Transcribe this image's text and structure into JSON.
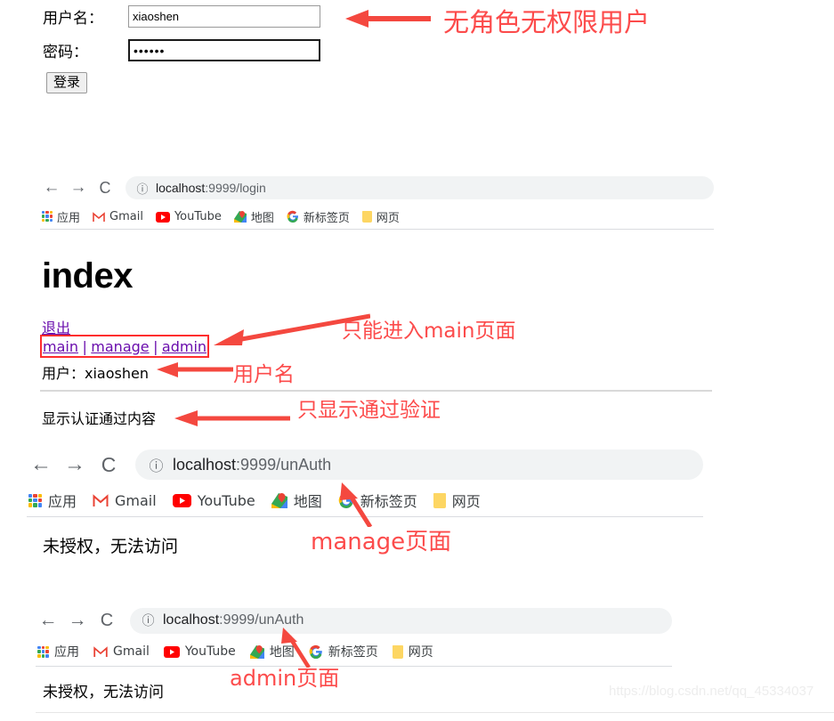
{
  "login_form": {
    "username_label": "用户名：",
    "username_value": "xiaoshen",
    "username_placeholder": "",
    "password_label": "密码：",
    "password_value": "••••••",
    "password_placeholder": "",
    "submit_label": "登录"
  },
  "browsers": [
    {
      "id": "browser-login",
      "back_icon": "←",
      "forward_icon": "→",
      "reload_icon": "C",
      "info_icon": "ⓘ",
      "url_host": "localhost",
      "url_path": ":9999/login",
      "bookmarks": [
        {
          "label": "应用",
          "icon": "apps-grid-icon"
        },
        {
          "label": "Gmail",
          "icon": "gmail-icon"
        },
        {
          "label": "YouTube",
          "icon": "youtube-icon"
        },
        {
          "label": "地图",
          "icon": "google-maps-icon"
        },
        {
          "label": "新标签页",
          "icon": "google-g-icon"
        },
        {
          "label": "网页",
          "icon": "folder-icon"
        }
      ]
    },
    {
      "id": "browser-unauth-manage",
      "back_icon": "←",
      "forward_icon": "→",
      "reload_icon": "C",
      "info_icon": "ⓘ",
      "url_host": "localhost",
      "url_path": ":9999/unAuth",
      "bookmarks": [
        {
          "label": "应用",
          "icon": "apps-grid-icon"
        },
        {
          "label": "Gmail",
          "icon": "gmail-icon"
        },
        {
          "label": "YouTube",
          "icon": "youtube-icon"
        },
        {
          "label": "地图",
          "icon": "google-maps-icon"
        },
        {
          "label": "新标签页",
          "icon": "google-g-icon"
        },
        {
          "label": "网页",
          "icon": "folder-icon"
        }
      ],
      "body_text": "未授权，无法访问"
    },
    {
      "id": "browser-unauth-admin",
      "back_icon": "←",
      "forward_icon": "→",
      "reload_icon": "C",
      "info_icon": "ⓘ",
      "url_host": "localhost",
      "url_path": ":9999/unAuth",
      "bookmarks": [
        {
          "label": "应用",
          "icon": "apps-grid-icon"
        },
        {
          "label": "Gmail",
          "icon": "gmail-icon"
        },
        {
          "label": "YouTube",
          "icon": "youtube-icon"
        },
        {
          "label": "地图",
          "icon": "google-maps-icon"
        },
        {
          "label": "新标签页",
          "icon": "google-g-icon"
        },
        {
          "label": "网页",
          "icon": "folder-icon"
        }
      ],
      "body_text": "未授权，无法访问"
    }
  ],
  "index_page": {
    "heading": "index",
    "logout_link": "退出",
    "nav_links": [
      "main",
      "manage",
      "admin"
    ],
    "nav_separator": "|",
    "user_prefix": "用户：",
    "user_name": "xiaoshen",
    "auth_content": "显示认证通过内容"
  },
  "annotations": [
    {
      "id": "anno-no-role",
      "text": "无角色无权限用户"
    },
    {
      "id": "anno-only-main",
      "text": "只能进入main页面"
    },
    {
      "id": "anno-username",
      "text": "用户名"
    },
    {
      "id": "anno-auth-only",
      "text": "只显示通过验证"
    },
    {
      "id": "anno-manage-page",
      "text": "manage页面"
    },
    {
      "id": "anno-admin-page",
      "text": "admin页面"
    }
  ],
  "watermark": "https://blog.csdn.net/qq_45334037",
  "colors": {
    "annotation_red": "#fc4b4b",
    "link_purple": "#6a0dad",
    "omnibox_bg": "#f1f3f4",
    "divider": "#dadce0"
  }
}
